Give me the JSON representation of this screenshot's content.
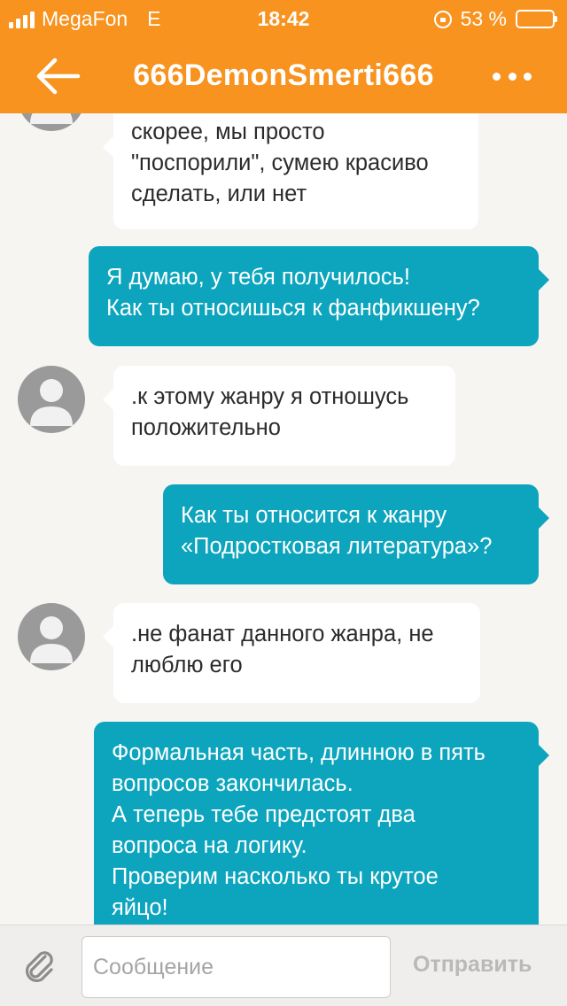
{
  "status_bar": {
    "carrier": "MegaFon",
    "network": "E",
    "time": "18:42",
    "battery_percent": "53 %",
    "battery_level": 0.53
  },
  "header": {
    "title": "666DemonSmerti666",
    "back_icon": "arrow-left-icon",
    "more_icon": "more-dots-icon",
    "color": "#f7931e"
  },
  "messages": [
    {
      "side": "in",
      "lines": [
        "скорее, мы просто",
        "\"поспорили\", сумею красиво",
        "сделать, или нет"
      ]
    },
    {
      "side": "out",
      "lines": [
        "Я думаю, у тебя получилось!",
        "Как ты относишься к фанфикшену?"
      ]
    },
    {
      "side": "in",
      "lines": [
        ".к этому жанру я отношусь",
        "положительно"
      ]
    },
    {
      "side": "out",
      "lines": [
        "Как ты относится к жанру",
        "«Подростковая литература»?"
      ]
    },
    {
      "side": "in",
      "lines": [
        ".не фанат данного жанра, не",
        "люблю его"
      ]
    },
    {
      "side": "out",
      "lines": [
        "Формальная часть, длинною в пять",
        "вопросов закончилась.",
        "А теперь тебе предстоят два",
        "вопроса на логику.",
        "Проверим насколько ты крутое",
        "яйцо!"
      ]
    }
  ],
  "composer": {
    "placeholder": "Сообщение",
    "value": "",
    "send_label": "Отправить",
    "attach_icon": "paperclip-icon"
  },
  "colors": {
    "outgoing_bubble": "#0ca5bd",
    "incoming_bubble": "#ffffff",
    "chat_background": "#f7f5f2"
  }
}
